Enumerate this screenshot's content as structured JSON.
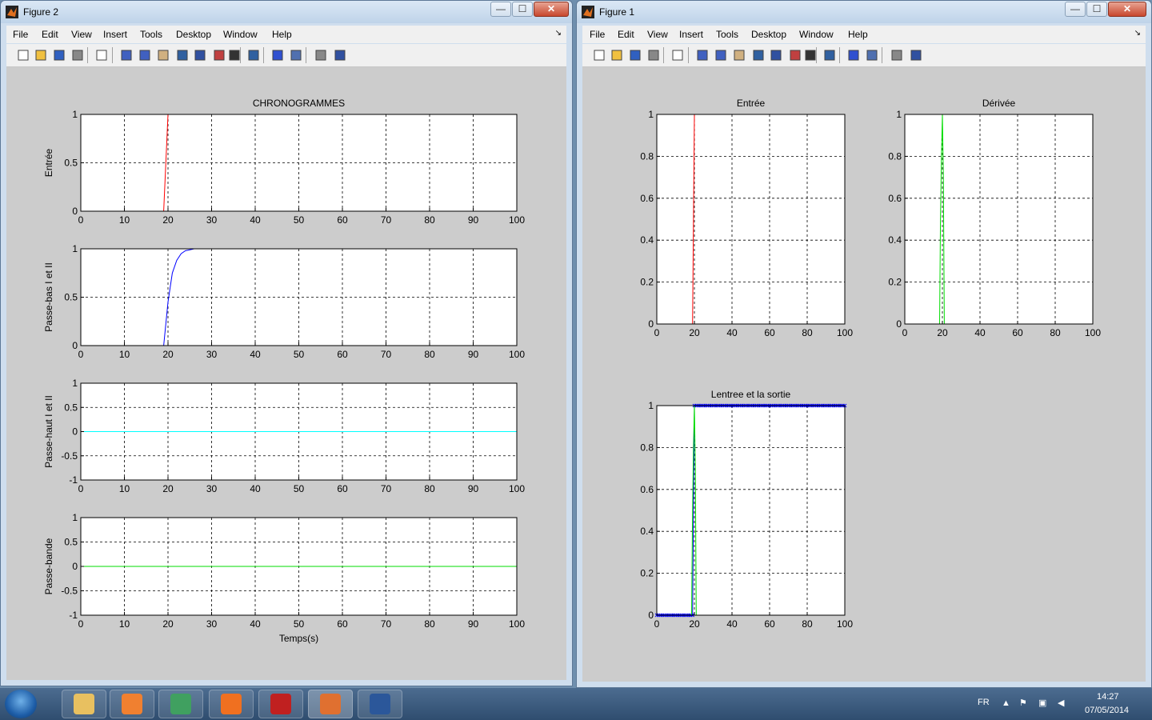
{
  "windows": [
    {
      "title": "Figure 2",
      "min": "—",
      "max": "☐",
      "close": "✕"
    },
    {
      "title": "Figure 1",
      "min": "—",
      "max": "☐",
      "close": "✕"
    }
  ],
  "menu": [
    "File",
    "Edit",
    "View",
    "Insert",
    "Tools",
    "Desktop",
    "Window",
    "Help"
  ],
  "toolbar_icons": [
    "new-figure-icon",
    "open-file-icon",
    "save-icon",
    "print-icon",
    "edit-plot-arrow-icon",
    "zoom-in-icon",
    "zoom-out-icon",
    "pan-hand-icon",
    "rotate-3d-icon",
    "data-cursor-icon",
    "brush-icon",
    "brush-dropdown-icon",
    "link-plot-icon",
    "colorbar-icon",
    "legend-icon",
    "hide-plot-tools-icon",
    "show-plot-tools-icon"
  ],
  "colors": {
    "red": "#ff0000",
    "blue": "#0000ff",
    "cyan": "#00ffff",
    "green": "#00dd00",
    "grid": "#000000"
  },
  "taskbar": {
    "lang": "FR",
    "time": "14:27",
    "date": "07/05/2014",
    "apps": [
      "explorer-icon",
      "media-player-icon",
      "notes-icon",
      "firefox-icon",
      "acrobat-icon",
      "matlab-icon",
      "word-icon"
    ]
  },
  "chart_data": [
    {
      "type": "line",
      "figure": "Figure 2",
      "title": "CHRONOGRAMMES",
      "xlabel": "",
      "ylabel": "Entrée",
      "xlim": [
        0,
        100
      ],
      "ylim": [
        0,
        1
      ],
      "xticks": [
        "0",
        "10",
        "20",
        "30",
        "40",
        "50",
        "60",
        "70",
        "80",
        "90",
        "100"
      ],
      "yticks": [
        "0",
        "0.5",
        "1"
      ],
      "grid": true,
      "series": [
        {
          "color": "#ff0000",
          "x": [
            0,
            19,
            20,
            100
          ],
          "y": [
            0,
            0,
            1,
            1
          ]
        }
      ]
    },
    {
      "type": "line",
      "figure": "Figure 2",
      "title": "",
      "xlabel": "",
      "ylabel": "Passe-bas I et II",
      "xlim": [
        0,
        100
      ],
      "ylim": [
        0,
        1
      ],
      "xticks": [
        "0",
        "10",
        "20",
        "30",
        "40",
        "50",
        "60",
        "70",
        "80",
        "90",
        "100"
      ],
      "yticks": [
        "0",
        "0.5",
        "1"
      ],
      "grid": true,
      "series": [
        {
          "color": "#00ffff",
          "x": [
            0,
            100
          ],
          "y": [
            0,
            0
          ]
        },
        {
          "color": "#0000ff",
          "x": [
            19,
            20,
            21,
            22,
            23,
            24,
            25,
            26,
            100
          ],
          "y": [
            0,
            0.45,
            0.75,
            0.88,
            0.95,
            0.98,
            0.99,
            1,
            1
          ]
        }
      ]
    },
    {
      "type": "line",
      "figure": "Figure 2",
      "title": "",
      "xlabel": "",
      "ylabel": "Passe-haut I et II",
      "xlim": [
        0,
        100
      ],
      "ylim": [
        -1,
        1
      ],
      "xticks": [
        "0",
        "10",
        "20",
        "30",
        "40",
        "50",
        "60",
        "70",
        "80",
        "90",
        "100"
      ],
      "yticks": [
        "-1",
        "-0.5",
        "0",
        "0.5",
        "1"
      ],
      "grid": true,
      "series": [
        {
          "color": "#00ffff",
          "x": [
            0,
            100
          ],
          "y": [
            0,
            0
          ]
        }
      ]
    },
    {
      "type": "line",
      "figure": "Figure 2",
      "title": "",
      "xlabel": "Temps(s)",
      "ylabel": "Passe-bande",
      "xlim": [
        0,
        100
      ],
      "ylim": [
        -1,
        1
      ],
      "xticks": [
        "0",
        "10",
        "20",
        "30",
        "40",
        "50",
        "60",
        "70",
        "80",
        "90",
        "100"
      ],
      "yticks": [
        "-1",
        "-0.5",
        "0",
        "0.5",
        "1"
      ],
      "grid": true,
      "series": [
        {
          "color": "#00dd00",
          "x": [
            0,
            100
          ],
          "y": [
            0,
            0
          ]
        }
      ]
    },
    {
      "type": "line",
      "figure": "Figure 1",
      "title": "Entrée",
      "xlabel": "",
      "ylabel": "",
      "xlim": [
        0,
        100
      ],
      "ylim": [
        0,
        1
      ],
      "xticks": [
        "0",
        "20",
        "40",
        "60",
        "80",
        "100"
      ],
      "yticks": [
        "0",
        "0.2",
        "0.4",
        "0.6",
        "0.8",
        "1"
      ],
      "grid": true,
      "series": [
        {
          "color": "#ff0000",
          "x": [
            0,
            19,
            20,
            100
          ],
          "y": [
            0,
            0,
            1,
            1
          ]
        }
      ]
    },
    {
      "type": "line",
      "figure": "Figure 1",
      "title": "Dérivée",
      "xlabel": "",
      "ylabel": "",
      "xlim": [
        0,
        100
      ],
      "ylim": [
        0,
        1
      ],
      "xticks": [
        "0",
        "20",
        "40",
        "60",
        "80",
        "100"
      ],
      "yticks": [
        "0",
        "0.2",
        "0.4",
        "0.6",
        "0.8",
        "1"
      ],
      "grid": true,
      "series": [
        {
          "color": "#00dd00",
          "x": [
            0,
            18.5,
            19,
            19.5,
            20,
            20.5,
            21,
            100
          ],
          "y": [
            0,
            0,
            0.5,
            0.8,
            1,
            0.7,
            0,
            0
          ]
        }
      ]
    },
    {
      "type": "line",
      "figure": "Figure 1",
      "title": "Lentree et la sortie",
      "xlabel": "",
      "ylabel": "",
      "xlim": [
        0,
        100
      ],
      "ylim": [
        0,
        1
      ],
      "xticks": [
        "0",
        "20",
        "40",
        "60",
        "80",
        "100"
      ],
      "yticks": [
        "0",
        "0.2",
        "0.4",
        "0.6",
        "0.8",
        "1"
      ],
      "grid": true,
      "series": [
        {
          "color": "#0000ff",
          "marker": "x",
          "x": [
            0,
            1,
            2,
            3,
            4,
            5,
            6,
            7,
            8,
            9,
            10,
            11,
            12,
            13,
            14,
            15,
            16,
            17,
            18,
            19,
            20,
            21,
            22,
            23,
            24,
            25,
            26,
            27,
            28,
            29,
            30,
            31,
            32,
            33,
            34,
            35,
            36,
            37,
            38,
            39,
            40,
            41,
            42,
            43,
            44,
            45,
            46,
            47,
            48,
            49,
            50,
            51,
            52,
            53,
            54,
            55,
            56,
            57,
            58,
            59,
            60,
            61,
            62,
            63,
            64,
            65,
            66,
            67,
            68,
            69,
            70,
            71,
            72,
            73,
            74,
            75,
            76,
            77,
            78,
            79,
            80,
            81,
            82,
            83,
            84,
            85,
            86,
            87,
            88,
            89,
            90,
            91,
            92,
            93,
            94,
            95,
            96,
            97,
            98,
            99,
            100
          ],
          "y": [
            0,
            0,
            0,
            0,
            0,
            0,
            0,
            0,
            0,
            0,
            0,
            0,
            0,
            0,
            0,
            0,
            0,
            0,
            0,
            0,
            1,
            1,
            1,
            1,
            1,
            1,
            1,
            1,
            1,
            1,
            1,
            1,
            1,
            1,
            1,
            1,
            1,
            1,
            1,
            1,
            1,
            1,
            1,
            1,
            1,
            1,
            1,
            1,
            1,
            1,
            1,
            1,
            1,
            1,
            1,
            1,
            1,
            1,
            1,
            1,
            1,
            1,
            1,
            1,
            1,
            1,
            1,
            1,
            1,
            1,
            1,
            1,
            1,
            1,
            1,
            1,
            1,
            1,
            1,
            1,
            1,
            1,
            1,
            1,
            1,
            1,
            1,
            1,
            1,
            1,
            1,
            1,
            1,
            1,
            1,
            1,
            1,
            1,
            1,
            1,
            1
          ]
        },
        {
          "color": "#00dd00",
          "x": [
            0,
            18.5,
            19,
            19.5,
            20,
            20.5,
            21,
            100
          ],
          "y": [
            0,
            0,
            0.5,
            0.8,
            1,
            0.7,
            0,
            0
          ]
        }
      ]
    }
  ]
}
